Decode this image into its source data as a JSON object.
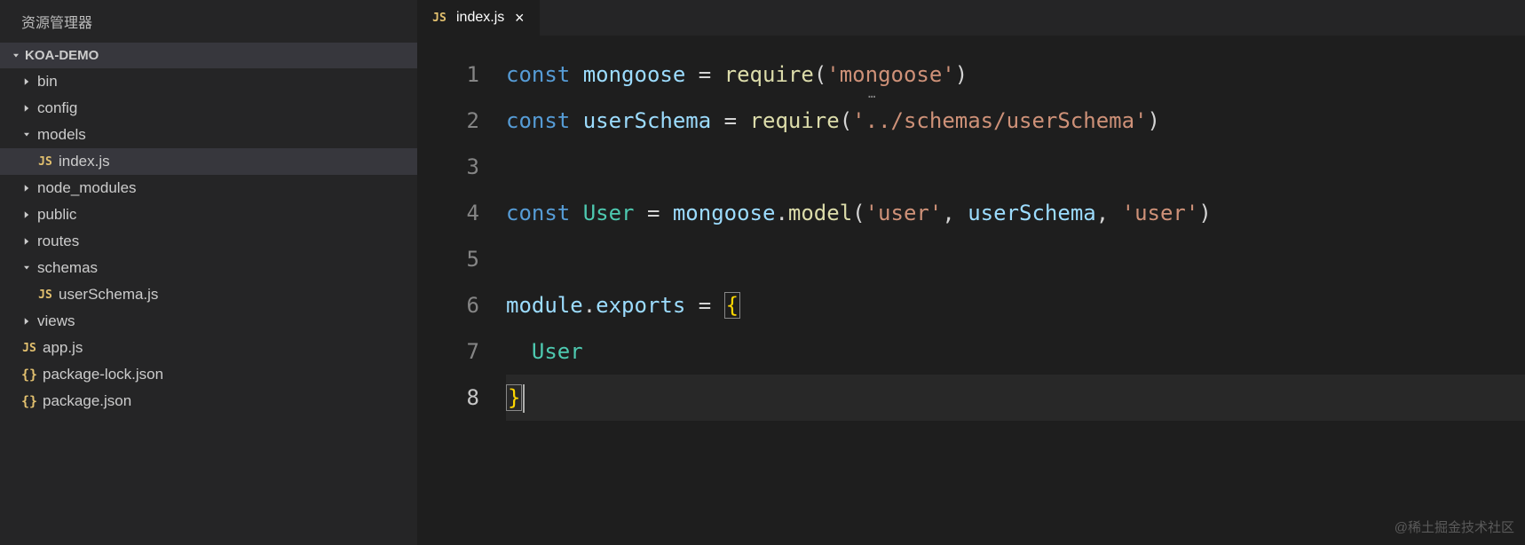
{
  "sidebar": {
    "title": "资源管理器",
    "root": "KOA-DEMO",
    "items": [
      {
        "label": "bin",
        "type": "folder",
        "expanded": false,
        "depth": 0
      },
      {
        "label": "config",
        "type": "folder",
        "expanded": false,
        "depth": 0
      },
      {
        "label": "models",
        "type": "folder",
        "expanded": true,
        "depth": 0
      },
      {
        "label": "index.js",
        "type": "js",
        "depth": 1,
        "active": true
      },
      {
        "label": "node_modules",
        "type": "folder",
        "expanded": false,
        "depth": 0
      },
      {
        "label": "public",
        "type": "folder",
        "expanded": false,
        "depth": 0
      },
      {
        "label": "routes",
        "type": "folder",
        "expanded": false,
        "depth": 0
      },
      {
        "label": "schemas",
        "type": "folder",
        "expanded": true,
        "depth": 0
      },
      {
        "label": "userSchema.js",
        "type": "js",
        "depth": 1
      },
      {
        "label": "views",
        "type": "folder",
        "expanded": false,
        "depth": 0
      },
      {
        "label": "app.js",
        "type": "js",
        "depth": 0
      },
      {
        "label": "package-lock.json",
        "type": "json",
        "depth": 0
      },
      {
        "label": "package.json",
        "type": "json",
        "depth": 0
      }
    ]
  },
  "tab": {
    "icon": "JS",
    "label": "index.js"
  },
  "code": {
    "lines": [
      {
        "n": 1,
        "tokens": [
          {
            "t": "const ",
            "c": "kw"
          },
          {
            "t": "mongoose",
            "c": "var"
          },
          {
            "t": " = ",
            "c": "punc"
          },
          {
            "t": "require",
            "c": "fn"
          },
          {
            "t": "(",
            "c": "punc"
          },
          {
            "t": "'mongoose'",
            "c": "str"
          },
          {
            "t": ")",
            "c": "punc"
          }
        ]
      },
      {
        "n": 2,
        "tokens": [
          {
            "t": "const ",
            "c": "kw"
          },
          {
            "t": "userSchema",
            "c": "var"
          },
          {
            "t": " = ",
            "c": "punc"
          },
          {
            "t": "require",
            "c": "fn"
          },
          {
            "t": "(",
            "c": "punc"
          },
          {
            "t": "'../schemas/userSchema'",
            "c": "str"
          },
          {
            "t": ")",
            "c": "punc"
          }
        ]
      },
      {
        "n": 3,
        "tokens": []
      },
      {
        "n": 4,
        "tokens": [
          {
            "t": "const ",
            "c": "kw"
          },
          {
            "t": "User",
            "c": "obj"
          },
          {
            "t": " = ",
            "c": "punc"
          },
          {
            "t": "mongoose",
            "c": "var"
          },
          {
            "t": ".",
            "c": "punc"
          },
          {
            "t": "model",
            "c": "fn"
          },
          {
            "t": "(",
            "c": "punc"
          },
          {
            "t": "'user'",
            "c": "str"
          },
          {
            "t": ", ",
            "c": "punc"
          },
          {
            "t": "userSchema",
            "c": "var"
          },
          {
            "t": ", ",
            "c": "punc"
          },
          {
            "t": "'user'",
            "c": "str"
          },
          {
            "t": ")",
            "c": "punc"
          }
        ]
      },
      {
        "n": 5,
        "tokens": []
      },
      {
        "n": 6,
        "tokens": [
          {
            "t": "module",
            "c": "var"
          },
          {
            "t": ".",
            "c": "punc"
          },
          {
            "t": "exports",
            "c": "var"
          },
          {
            "t": " = ",
            "c": "punc"
          },
          {
            "t": "{",
            "c": "brace",
            "box": true
          }
        ]
      },
      {
        "n": 7,
        "tokens": [
          {
            "t": "  ",
            "c": "punc"
          },
          {
            "t": "User",
            "c": "obj"
          }
        ]
      },
      {
        "n": 8,
        "current": true,
        "tokens": [
          {
            "t": "}",
            "c": "brace",
            "box": true
          }
        ]
      }
    ]
  },
  "hint": "…",
  "watermark": "@稀土掘金技术社区"
}
